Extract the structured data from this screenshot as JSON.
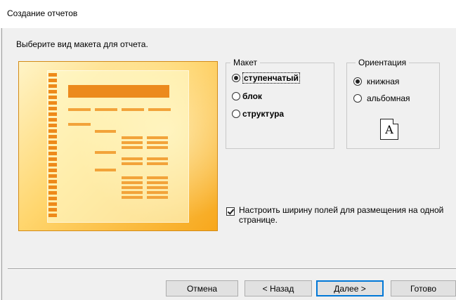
{
  "window": {
    "title": "Создание отчетов"
  },
  "prompt": "Выберите вид макета для отчета.",
  "layout_group": {
    "label": "Макет",
    "options": [
      {
        "label": "ступенчатый",
        "selected": true
      },
      {
        "label": "блок",
        "selected": false
      },
      {
        "label": "структура",
        "selected": false
      }
    ]
  },
  "orientation_group": {
    "label": "Ориентация",
    "options": [
      {
        "label": "книжная",
        "selected": true
      },
      {
        "label": "альбомная",
        "selected": false
      }
    ],
    "page_icon_letter": "A"
  },
  "fit_checkbox": {
    "label": "Настроить ширину полей для размещения на одной странице.",
    "checked": true
  },
  "buttons": {
    "cancel": "Отмена",
    "back": "< Назад",
    "next": "Далее >",
    "finish": "Готово"
  },
  "colors": {
    "preview_accent": "#ec8a1d",
    "preview_light": "#fff4c7",
    "default_button_border": "#0078d7"
  }
}
